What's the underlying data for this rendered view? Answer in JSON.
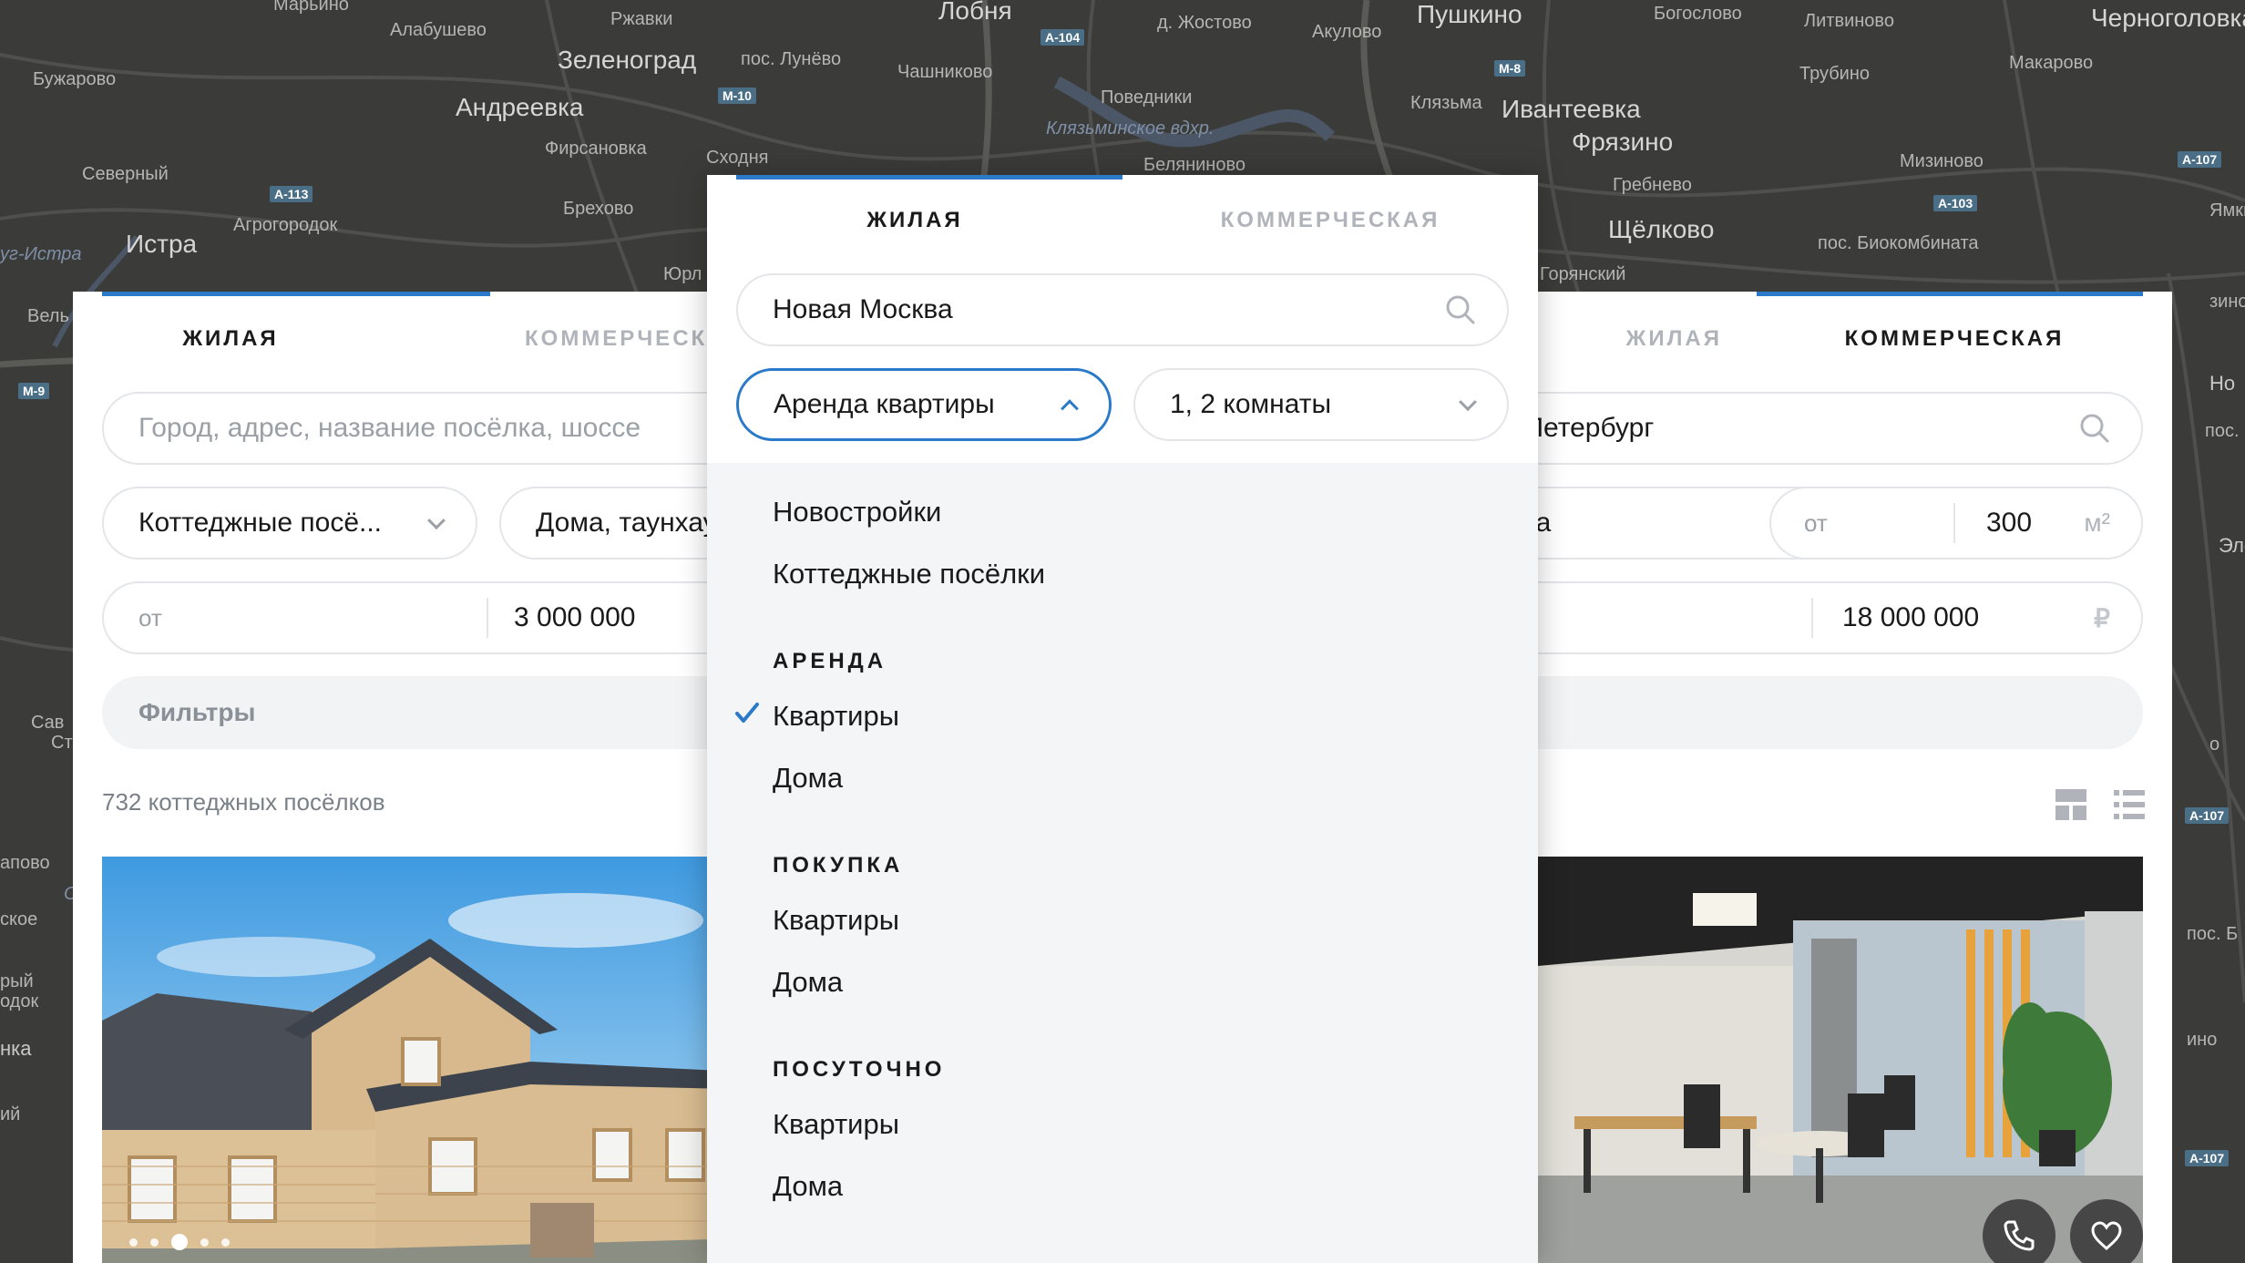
{
  "map": {
    "labels": [
      {
        "t": "Марьино",
        "c": "small"
      },
      {
        "t": "Ржавки",
        "c": "small"
      },
      {
        "t": "Лобня",
        "c": "big"
      },
      {
        "t": "д. Жостово",
        "c": "small"
      },
      {
        "t": "Акулово",
        "c": "small"
      },
      {
        "t": "Пушкино",
        "c": "big"
      },
      {
        "t": "Богослово",
        "c": "small"
      },
      {
        "t": "Литвиново",
        "c": "small"
      },
      {
        "t": "Черноголовка",
        "c": "big"
      },
      {
        "t": "Бужарово",
        "c": "small"
      },
      {
        "t": "Алабушево",
        "c": "small"
      },
      {
        "t": "Зеленоград",
        "c": "big"
      },
      {
        "t": "пос. Лунёво",
        "c": "small"
      },
      {
        "t": "Чашниково",
        "c": "small"
      },
      {
        "t": "Трубино",
        "c": "small"
      },
      {
        "t": "Макарово",
        "c": "small"
      },
      {
        "t": "Андреевка",
        "c": "big"
      },
      {
        "t": "Поведники",
        "c": "small"
      },
      {
        "t": "Клязьма",
        "c": "small"
      },
      {
        "t": "Ивантеевка",
        "c": "big"
      },
      {
        "t": "Клязьминское вдхр.",
        "c": "water"
      },
      {
        "t": "Фирсановка",
        "c": "small"
      },
      {
        "t": "Сходня",
        "c": "small"
      },
      {
        "t": "Беляниново",
        "c": "small"
      },
      {
        "t": "Фрязино",
        "c": "big"
      },
      {
        "t": "Мизиново",
        "c": "small"
      },
      {
        "t": "Северный",
        "c": "small"
      },
      {
        "t": "Гребнево",
        "c": "small"
      },
      {
        "t": "Брехово",
        "c": "small"
      },
      {
        "t": "Ямкино",
        "c": "small"
      },
      {
        "t": "Агрогородок",
        "c": "small"
      },
      {
        "t": "Щёлково",
        "c": "big"
      },
      {
        "t": "Истра",
        "c": "big"
      },
      {
        "t": "пос. Биокомбината",
        "c": "small"
      },
      {
        "t": "Горянский",
        "c": "small"
      },
      {
        "t": "Юрл",
        "c": "small"
      },
      {
        "t": "Вель",
        "c": "small"
      },
      {
        "t": "зино",
        "c": "small"
      },
      {
        "t": "Но",
        "c": "mid"
      },
      {
        "t": "пос. Радиоце",
        "c": "small"
      },
      {
        "t": "Элект",
        "c": "mid"
      },
      {
        "t": "апово",
        "c": "small"
      },
      {
        "t": "Один",
        "c": "water"
      },
      {
        "t": "ское",
        "c": "small"
      },
      {
        "t": "рый",
        "c": "small"
      },
      {
        "t": "одок",
        "c": "small"
      },
      {
        "t": "нка",
        "c": "mid"
      },
      {
        "t": "Сав",
        "c": "small"
      },
      {
        "t": "Ст",
        "c": "small"
      },
      {
        "t": "пос. Б",
        "c": "small"
      },
      {
        "t": "ино",
        "c": "small"
      },
      {
        "t": "ий",
        "c": "small"
      },
      {
        "t": "уг-Истра",
        "c": "water"
      },
      {
        "t": "о",
        "c": "small"
      }
    ],
    "badges": [
      "A-104",
      "M-8",
      "M-10",
      "A-113",
      "A-103",
      "A-107",
      "A-107",
      "A-107",
      "M-9"
    ]
  },
  "left": {
    "tabs": [
      "ЖИЛАЯ",
      "КОММЕРЧЕСКАЯ"
    ],
    "search_placeholder": "Город, адрес, название посёлка, шоссе",
    "type_select": "Коттеджные посё...",
    "subtype_select": "Дома, таунхаусы",
    "price_from_label": "от",
    "price_to": "3 000 000",
    "filters_label": "Фильтры",
    "count": "732 коттеджных посёлков"
  },
  "right": {
    "tabs": [
      "ЖИЛАЯ",
      "КОММЕРЧЕСКАЯ"
    ],
    "search_value": "Санкт-Петербург",
    "type_select": "Аренда офиса",
    "area_from_label": "от",
    "area_to": "300",
    "area_unit": "м²",
    "price_to": "18 000 000",
    "price_unit": "₽"
  },
  "mid": {
    "tabs": [
      "ЖИЛАЯ",
      "КОММЕРЧЕСКАЯ"
    ],
    "search_value": "Новая Москва",
    "deal_select": "Аренда квартиры",
    "rooms_select": "1, 2 комнаты",
    "top_items": [
      "Новостройки",
      "Коттеджные посёлки"
    ],
    "groups": [
      {
        "title": "АРЕНДА",
        "items": [
          "Квартиры",
          "Дома"
        ]
      },
      {
        "title": "ПОКУПКА",
        "items": [
          "Квартиры",
          "Дома"
        ]
      },
      {
        "title": "ПОСУТОЧНО",
        "items": [
          "Квартиры",
          "Дома"
        ]
      }
    ]
  },
  "colors": {
    "accent": "#2a7ac9",
    "map_bg": "#3b3c3a"
  }
}
